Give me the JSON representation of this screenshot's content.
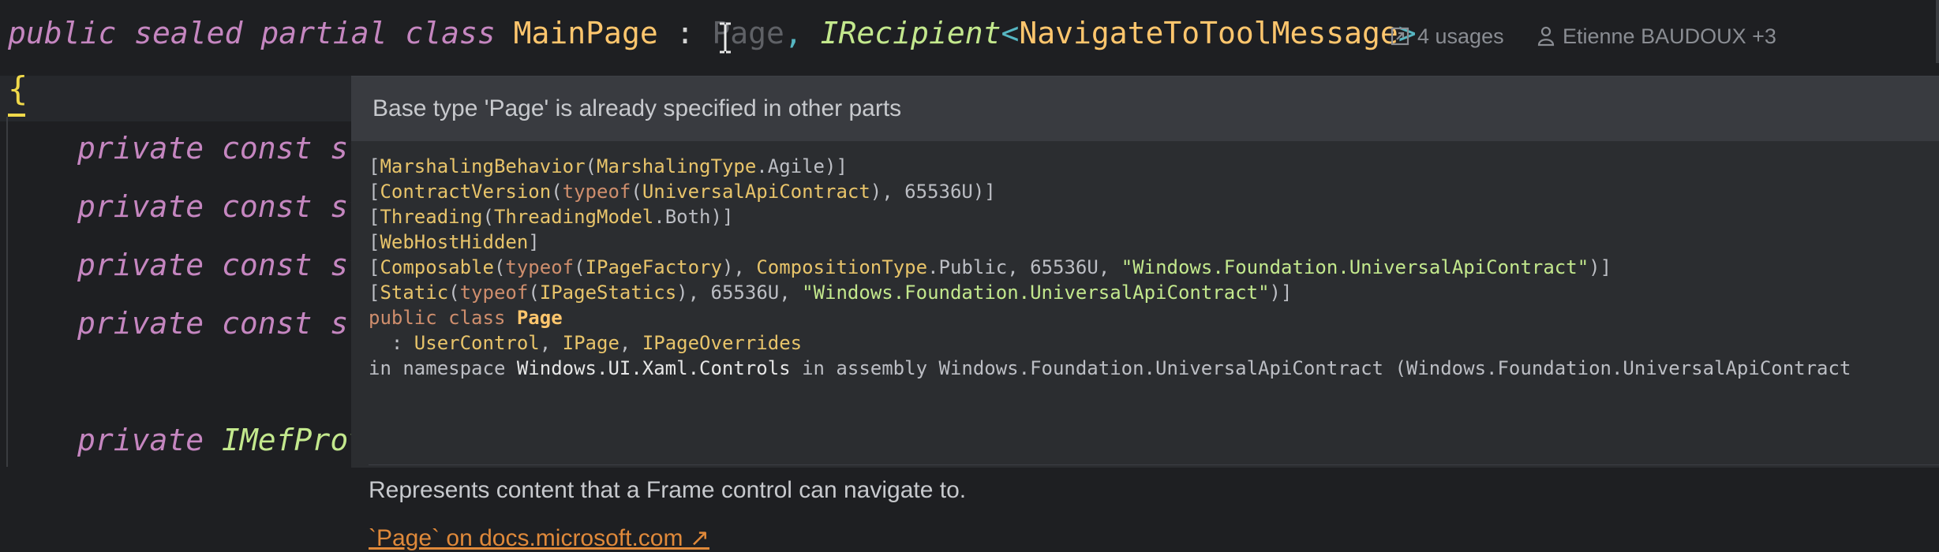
{
  "editor": {
    "decl": {
      "kw_public": "public",
      "kw_sealed": "sealed",
      "kw_partial": "partial",
      "kw_class": "class",
      "class_name": "MainPage",
      "colon": ":",
      "base_page": "Page",
      "comma": ",",
      "iface_name": "IRecipient",
      "lt": "<",
      "generic_arg": "NavigateToToolMessage",
      "gt": ">"
    },
    "inlay_usages": "4 usages",
    "inlay_authors": "Etienne BAUDOUX +3",
    "brace": "{",
    "lines": [
      {
        "kw1": "private",
        "kw2": "const",
        "frag": "st"
      },
      {
        "kw1": "private",
        "kw2": "const",
        "frag": "st"
      },
      {
        "kw1": "private",
        "kw2": "const",
        "frag": "st"
      },
      {
        "kw1": "private",
        "kw2": "const",
        "frag": "st"
      }
    ],
    "last_line": {
      "kw1": "private",
      "frag": "IMefProv"
    }
  },
  "popup": {
    "header": "Base type 'Page' is already specified in other parts",
    "sig": {
      "l1": {
        "open": "[",
        "attr": "MarshalingBehavior",
        "p1": "(",
        "type": "MarshalingType",
        "dot": ".",
        "val": "Agile",
        "close": ")]"
      },
      "l2": {
        "open": "[",
        "attr": "ContractVersion",
        "p1": "(",
        "kw": "typeof",
        "p2": "(",
        "type": "UniversalApiContract",
        "mid": "), ",
        "num": "65536U",
        "close": ")]"
      },
      "l3": {
        "open": "[",
        "attr": "Threading",
        "p1": "(",
        "type": "ThreadingModel",
        "dot": ".",
        "val": "Both",
        "close": ")]"
      },
      "l4": {
        "open": "[",
        "attr": "WebHostHidden",
        "close": "]"
      },
      "l5": {
        "open": "[",
        "attr": "Composable",
        "p1": "(",
        "kw": "typeof",
        "p2": "(",
        "type": "IPageFactory",
        "mid": "), ",
        "type2": "CompositionType",
        "dot": ".",
        "val": "Public",
        "c1": ", ",
        "num": "65536U",
        "c2": ", ",
        "str": "\"Windows.Foundation.UniversalApiContract\"",
        "close": ")]"
      },
      "l6": {
        "open": "[",
        "attr": "Static",
        "p1": "(",
        "kw": "typeof",
        "p2": "(",
        "type": "IPageStatics",
        "mid": "), ",
        "num": "65536U",
        "c2": ", ",
        "str": "\"Windows.Foundation.UniversalApiContract\"",
        "close": ")]"
      },
      "l7": {
        "kw1": "public",
        "kw2": "class",
        "name": "Page"
      },
      "l8": {
        "colon": "  : ",
        "t1": "UserControl",
        "c1": ", ",
        "t2": "IPage",
        "c2": ", ",
        "t3": "IPageOverrides"
      },
      "l9": {
        "pre": "in namespace ",
        "ns": "Windows.UI.Xaml.Controls",
        "mid": " in assembly ",
        "asm": "Windows.Foundation.UniversalApiContract (Windows.Foundation.UniversalApiContract"
      }
    },
    "description": "Represents content that a Frame control can navigate to.",
    "doc_link": "`Page` on docs.microsoft.com ↗"
  }
}
